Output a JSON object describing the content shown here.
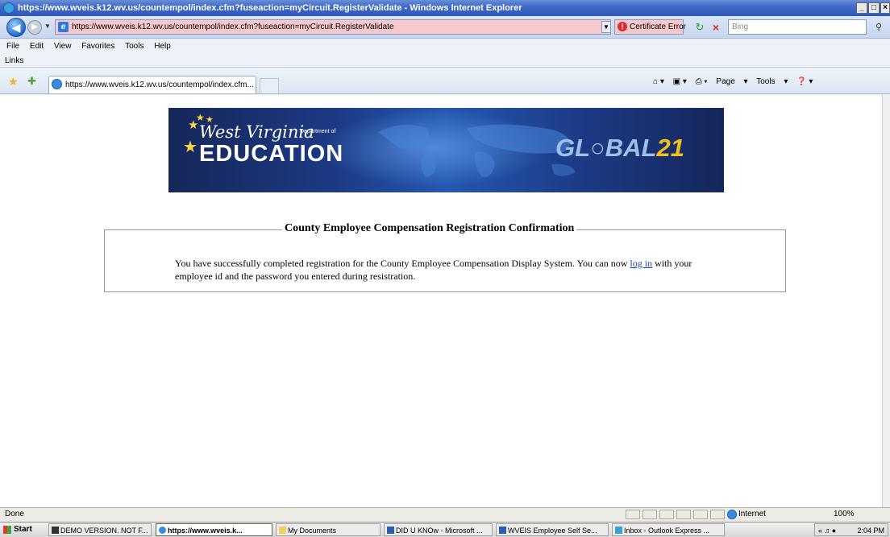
{
  "window": {
    "title": "https://www.wveis.k12.wv.us/countempol/index.cfm?fuseaction=myCircuit.RegisterValidate - Windows Internet Explorer",
    "minimize": "_",
    "maximize": "□",
    "close": "×"
  },
  "address_bar": {
    "url": "https://www.wveis.k12.wv.us/countempol/index.cfm?fuseaction=myCircuit.RegisterValidate",
    "certificate_error": "Certificate Error",
    "search_placeholder": "Bing"
  },
  "menu": [
    "File",
    "Edit",
    "View",
    "Favorites",
    "Tools",
    "Help"
  ],
  "links_label": "Links",
  "tab": {
    "label": "https://www.wveis.k12.wv.us/countempol/index.cfm..."
  },
  "command_bar": {
    "page": "Page",
    "tools": "Tools"
  },
  "banner": {
    "wv_script": "West Virginia",
    "department": "Department of",
    "education": "EDUCATION",
    "global": "GL○BAL",
    "global_num": "21"
  },
  "confirmation": {
    "title": "County Employee Compensation Registration Confirmation",
    "message_before": "You have successfully completed registration for the County Employee Compensation Display System. You can now ",
    "link": "log in",
    "message_after": " with your employee id and the password you entered during resistration."
  },
  "status": {
    "text": "Done",
    "zone": "Internet",
    "zoom": "100%"
  },
  "taskbar": {
    "start": "Start",
    "items": [
      "DEMO VERSION. NOT F...",
      "https://www.wveis.k...",
      "My Documents",
      "DID U KNOw - Microsoft ...",
      "WVEIS Employee Self Se...",
      "Inbox - Outlook Express ..."
    ],
    "clock": "2:04 PM"
  },
  "colors": {
    "titlebar": "#2d58b8",
    "address_error_bg": "#f7c8cc",
    "banner_bg": "#1c3a84",
    "link": "#1a3fbf"
  }
}
